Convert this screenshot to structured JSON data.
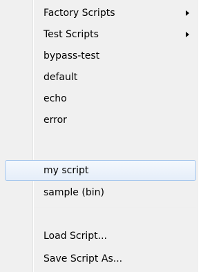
{
  "menu": {
    "items": [
      {
        "label": "Factory Scripts",
        "submenu": true
      },
      {
        "label": "Test Scripts",
        "submenu": true
      },
      {
        "label": "bypass-test",
        "submenu": false
      },
      {
        "label": "default",
        "submenu": false
      },
      {
        "label": "echo",
        "submenu": false
      },
      {
        "label": "error",
        "submenu": false
      },
      {
        "label": "my script",
        "submenu": false,
        "highlighted": true
      },
      {
        "label": "sample (bin)",
        "submenu": false
      }
    ],
    "actions": [
      {
        "label": "Load Script..."
      },
      {
        "label": "Save Script As..."
      }
    ],
    "colors": {
      "background": "#f0f0f0",
      "highlight_border": "#a8c8ed",
      "highlight_fill": "#e5eef9"
    }
  }
}
